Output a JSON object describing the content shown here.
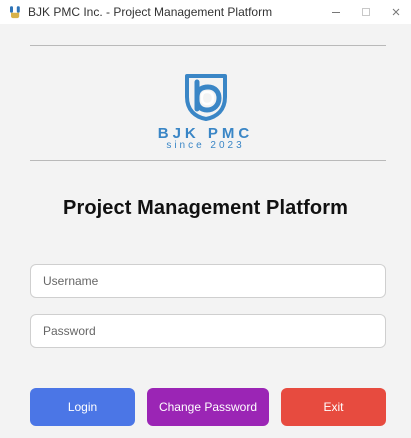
{
  "window": {
    "title": "BJK PMC Inc. - Project Management Platform",
    "icon": "app-icon"
  },
  "logo": {
    "brand": "BJK PMC",
    "since": "since 2023",
    "color": "#3a86c6"
  },
  "main": {
    "title": "Project Management Platform"
  },
  "form": {
    "username_placeholder": "Username",
    "password_placeholder": "Password",
    "username_value": "",
    "password_value": ""
  },
  "buttons": {
    "login": "Login",
    "change_password": "Change Password",
    "exit": "Exit"
  },
  "colors": {
    "login": "#4b76e6",
    "change_password": "#9b25b5",
    "exit": "#e74b3f"
  }
}
